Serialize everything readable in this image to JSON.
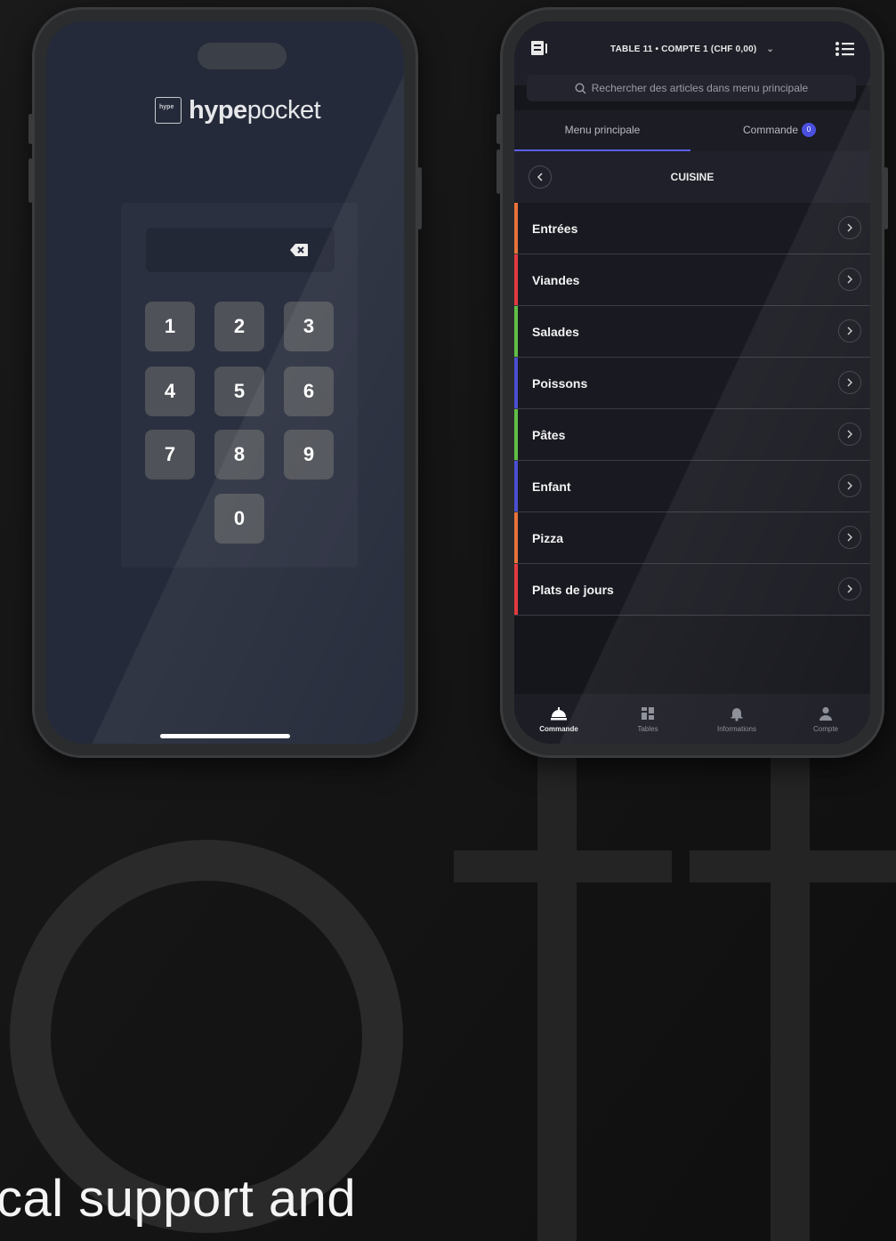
{
  "left_phone": {
    "logo_word_bold": "hype",
    "logo_word_light": "pocket",
    "logo_box_text": "hype",
    "keypad": [
      "1",
      "2",
      "3",
      "4",
      "5",
      "6",
      "7",
      "8",
      "9",
      "0"
    ]
  },
  "right_phone": {
    "header_title": "TABLE 11 • COMPTE 1 (CHF 0,00)",
    "search_placeholder": "Rechercher des articles dans menu principale",
    "tabs": [
      {
        "label": "Menu principale",
        "active": true
      },
      {
        "label": "Commande",
        "badge": "0"
      }
    ],
    "section_title": "CUISINE",
    "categories": [
      {
        "label": "Entrées",
        "color": "#e8733a"
      },
      {
        "label": "Viandes",
        "color": "#e33a3f"
      },
      {
        "label": "Salades",
        "color": "#5fbf45"
      },
      {
        "label": "Poissons",
        "color": "#4a4fd0"
      },
      {
        "label": "Pâtes",
        "color": "#5fbf45"
      },
      {
        "label": "Enfant",
        "color": "#4a4fd0"
      },
      {
        "label": "Pizza",
        "color": "#e8733a"
      },
      {
        "label": "Plats de jours",
        "color": "#e33a3f"
      }
    ],
    "bottom_nav": [
      {
        "label": "Commande",
        "icon": "service-bell-icon",
        "active": true
      },
      {
        "label": "Tables",
        "icon": "tables-icon"
      },
      {
        "label": "Informations",
        "icon": "bell-icon"
      },
      {
        "label": "Compte",
        "icon": "user-icon"
      }
    ]
  },
  "footer_text": "cal support and"
}
